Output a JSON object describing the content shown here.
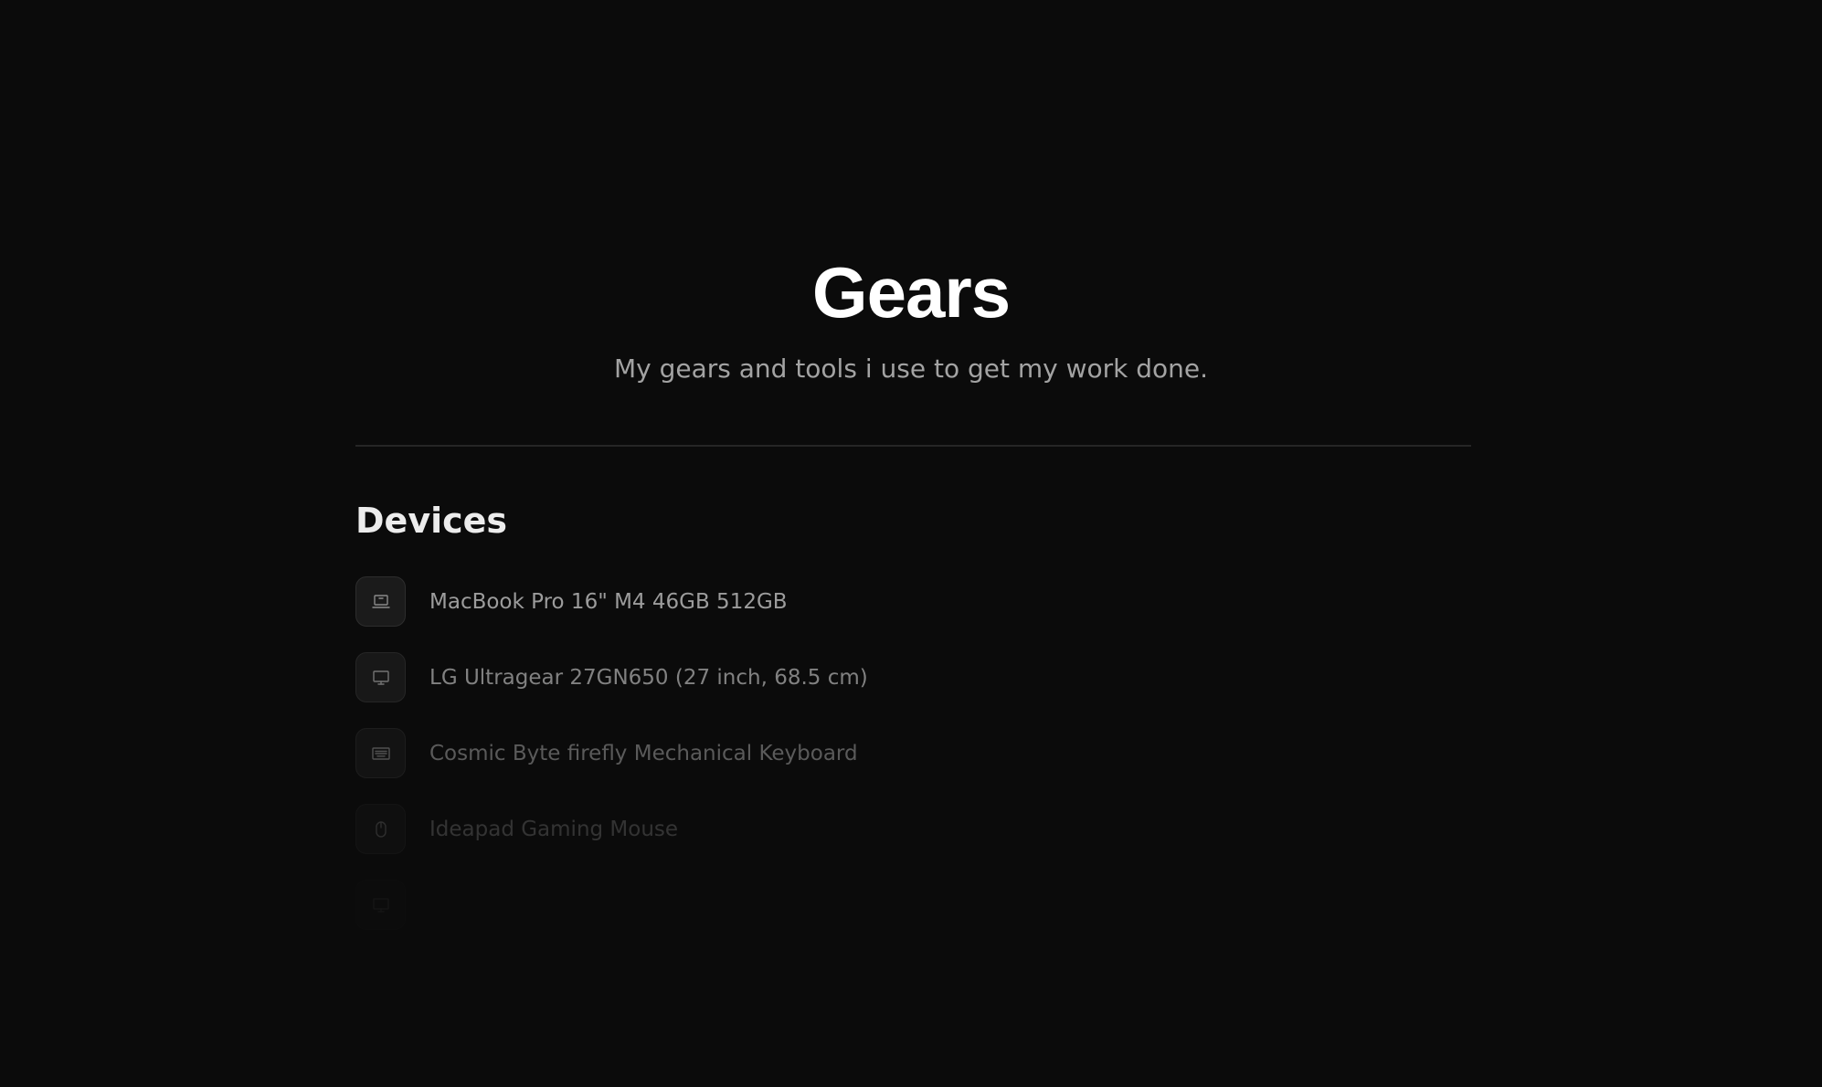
{
  "header": {
    "title": "Gears",
    "subtitle": "My gears and tools i use to get my work done."
  },
  "devices": {
    "heading": "Devices",
    "items": [
      {
        "label": "MacBook Pro 16\" M4 46GB 512GB",
        "icon": "laptop-icon"
      },
      {
        "label": "LG Ultragear 27GN650 (27 inch, 68.5 cm)",
        "icon": "monitor-icon"
      },
      {
        "label": "Cosmic Byte firefly Mechanical Keyboard",
        "icon": "keyboard-icon"
      },
      {
        "label": "Ideapad Gaming Mouse",
        "icon": "mouse-icon"
      },
      {
        "label": "",
        "icon": "monitor-icon"
      }
    ]
  },
  "colors": {
    "background": "#0b0b0b",
    "title": "#ffffff",
    "subtitle": "#a3a3a3",
    "item_text": "#9c9c9c",
    "icon_box": "#1b1b1b",
    "divider": "#262626"
  }
}
